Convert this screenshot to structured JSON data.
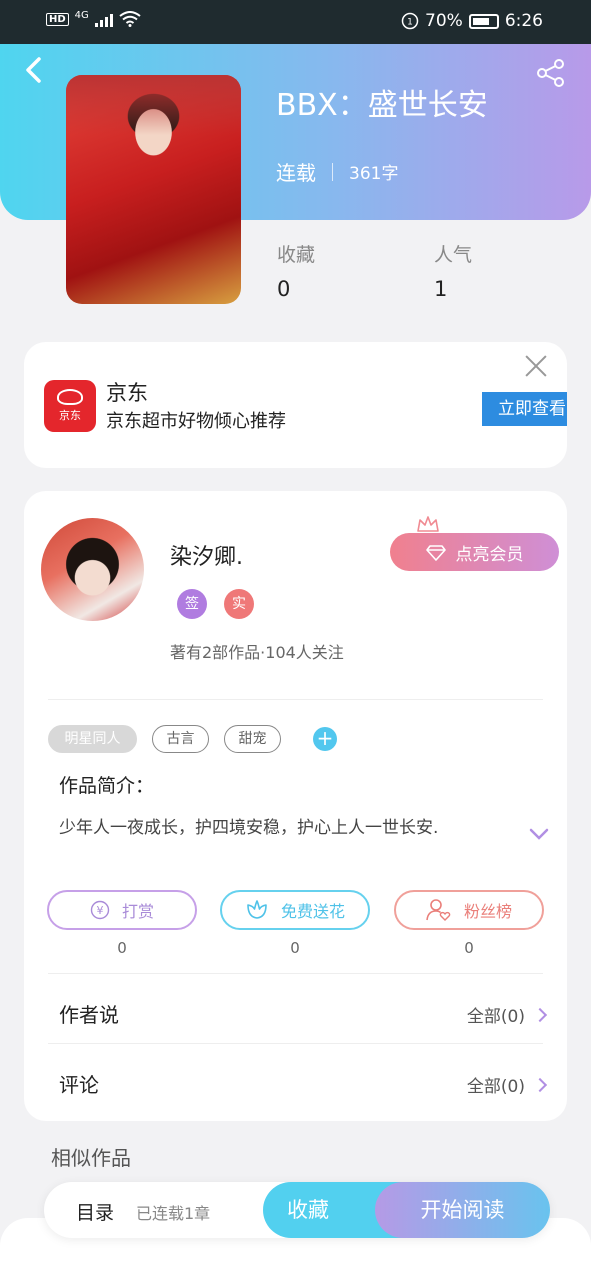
{
  "status_bar": {
    "network_badge": "HD",
    "network_type": "4G",
    "battery_percent": "70%",
    "time": "6:26",
    "icons": [
      "hd-icon",
      "signal-icon",
      "wifi-icon",
      "data-saver-icon",
      "battery-icon"
    ]
  },
  "header": {
    "back_icon": "back-arrow-icon",
    "share_icon": "share-icon",
    "gradient_colors": [
      "#4fd5ef",
      "#86b9ee",
      "#b89ae9"
    ]
  },
  "book": {
    "title": "BBX：盛世长安",
    "status": "连载",
    "word_count": "361字",
    "stats": [
      {
        "label": "收藏",
        "value": "0"
      },
      {
        "label": "人气",
        "value": "1"
      }
    ]
  },
  "ad": {
    "logo_text": "京东",
    "name": "京东",
    "description": "京东超市好物倾心推荐",
    "cta": "立即查看",
    "brand_color": "#e4262c"
  },
  "author": {
    "name": "染汐卿.",
    "badges": [
      "签",
      "实"
    ],
    "meta": "著有2部作品·104人关注",
    "vip_button": "点亮会员"
  },
  "tags": {
    "items": [
      "明星同人",
      "古言",
      "甜宠"
    ],
    "add_label": "+"
  },
  "intro": {
    "label": "作品简介：",
    "text": "少年人一夜成长，护四境安稳，护心上人一世长安."
  },
  "actions": [
    {
      "label": "打赏",
      "count": "0",
      "icon": "yen-icon"
    },
    {
      "label": "免费送花",
      "count": "0",
      "icon": "flower-icon"
    },
    {
      "label": "粉丝榜",
      "count": "0",
      "icon": "fan-heart-icon"
    }
  ],
  "rows": {
    "author_says": {
      "label": "作者说",
      "right": "全部(0)"
    },
    "comments": {
      "label": "评论",
      "right": "全部(0)"
    }
  },
  "similar": {
    "title": "相似作品"
  },
  "bottom_bar": {
    "catalog": "目录",
    "serial_info": "已连载1章",
    "favorite": "收藏",
    "start_reading": "开始阅读"
  }
}
